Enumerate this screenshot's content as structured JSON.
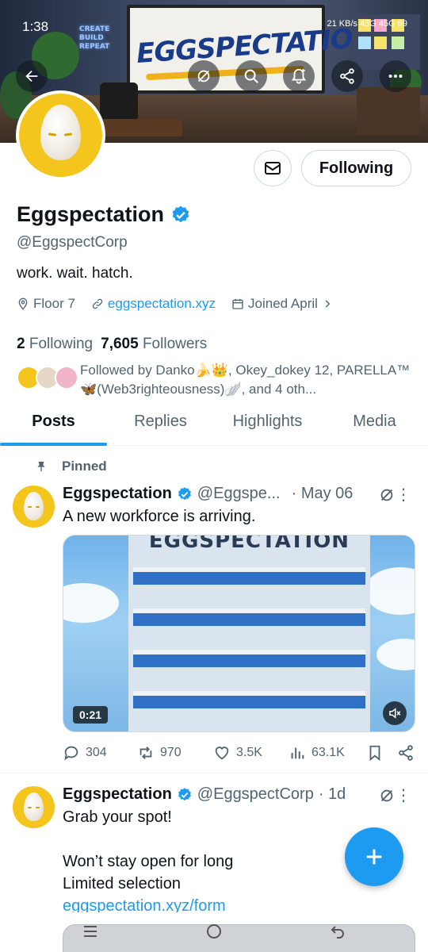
{
  "status_bar": {
    "time": "1:38",
    "right_text": "21 KB/s  45G  45G  69"
  },
  "banner": {
    "board_title": "EGGSPECTATION",
    "neon_text": "CREATE BUILD REPEAT"
  },
  "header_actions": {
    "back_icon": "arrow-left-icon",
    "icons": [
      "no-repost-icon",
      "search-icon",
      "notification-bell-icon",
      "share-icon",
      "more-icon"
    ]
  },
  "profile": {
    "display_name": "Eggspectation",
    "handle": "@EggspectCorp",
    "bio": "work. wait. hatch.",
    "location": "Floor 7",
    "website": "eggspectation.xyz",
    "joined": "Joined April",
    "following_count": "2",
    "following_label": "Following",
    "followers_count": "7,605",
    "followers_label": "Followers",
    "followed_by": "Followed by Danko🍌👑, Okey_dokey 12, PARELLA™🦋(Web3righteousness)🪽, and 4 oth...",
    "follow_button": "Following"
  },
  "tabs": [
    {
      "label": "Posts",
      "active": true
    },
    {
      "label": "Replies",
      "active": false
    },
    {
      "label": "Highlights",
      "active": false
    },
    {
      "label": "Media",
      "active": false
    }
  ],
  "posts": [
    {
      "pinned_label": "Pinned",
      "author": "Eggspectation",
      "handle": "@Eggspe...",
      "time": "· May 06",
      "text": "A new workforce is arriving.",
      "media_title": "EGGSPECTATION",
      "video_duration": "0:21",
      "replies": "304",
      "reposts": "970",
      "likes": "3.5K",
      "views": "63.1K"
    },
    {
      "author": "Eggspectation",
      "handle": "@EggspectCorp",
      "time": "· 1d",
      "line1": "Grab your spot!",
      "line2": "Won’t stay open for long",
      "line3": "Limited selection",
      "link": "eggspectation.xyz/form"
    }
  ],
  "colors": {
    "accent": "#1d9bf0",
    "secondary_text": "#536471",
    "primary_text": "#0f1419",
    "avatar_bg": "#f4c51c"
  }
}
